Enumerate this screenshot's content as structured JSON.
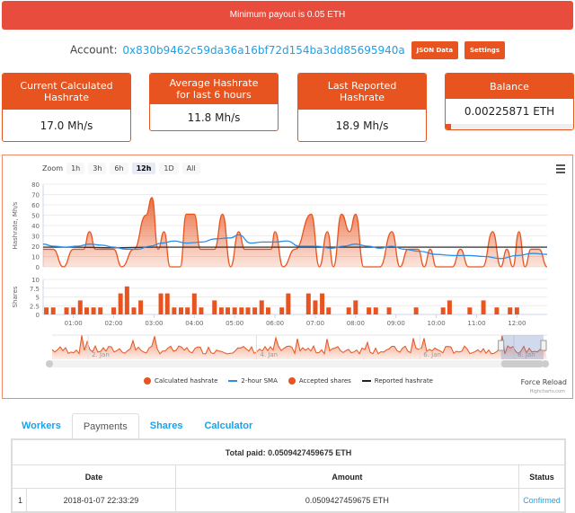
{
  "alert": {
    "text": "Minimum payout is 0.05 ETH"
  },
  "account": {
    "label": "Account:",
    "address": "0x830b9462c59da36a16bf72d154ba3dd85695940a",
    "json_button": "JSON Data",
    "settings_button": "Settings"
  },
  "cards": [
    {
      "title": "Current Calculated Hashrate",
      "value": "17.0 Mh/s"
    },
    {
      "title": "Average Hashrate for last 6 hours",
      "value": "11.8 Mh/s"
    },
    {
      "title": "Last Reported Hashrate",
      "value": "18.9 Mh/s"
    },
    {
      "title": "Balance",
      "value": "0.00225871 ETH",
      "progress": 0.045
    }
  ],
  "chart": {
    "zoom_label": "Zoom",
    "zoom_buttons": [
      "1h",
      "3h",
      "6h",
      "12h",
      "1D",
      "All"
    ],
    "active_zoom": "12h",
    "legend": [
      "Calculated hashrate",
      "2-hour SMA",
      "Accepted shares",
      "Reported hashrate"
    ],
    "force_reload": "Force Reload",
    "credits": "Highcharts.com",
    "colors": {
      "calculated": "#e8541f",
      "sma": "#2b8fe8",
      "shares": "#e8541f",
      "reported": "#333333"
    }
  },
  "chart_data": {
    "type": "line",
    "x_labels": [
      "01:00",
      "02:00",
      "03:00",
      "04:00",
      "05:00",
      "06:00",
      "07:00",
      "08:00",
      "09:00",
      "10:00",
      "11:00",
      "12:00"
    ],
    "x_range_hours": [
      0.25,
      12.35
    ],
    "hashrate_axis": {
      "label": "Hashrate, Mh/s",
      "ticks": [
        0,
        10,
        20,
        30,
        40,
        50,
        60,
        70,
        80
      ],
      "ylim": [
        0,
        80
      ]
    },
    "shares_axis": {
      "label": "Shares",
      "ticks": [
        "0",
        "2.5",
        "5",
        "7.5",
        "10"
      ],
      "ylim": [
        0,
        10
      ]
    },
    "series": [
      {
        "name": "Calculated hashrate",
        "type": "area",
        "points": [
          [
            0.25,
            17
          ],
          [
            0.5,
            17
          ],
          [
            0.75,
            0
          ],
          [
            1.0,
            17
          ],
          [
            1.25,
            17
          ],
          [
            1.4,
            34
          ],
          [
            1.55,
            17
          ],
          [
            2.0,
            17
          ],
          [
            2.2,
            0
          ],
          [
            2.5,
            17
          ],
          [
            2.8,
            50
          ],
          [
            2.95,
            67
          ],
          [
            3.1,
            17
          ],
          [
            3.25,
            34
          ],
          [
            3.4,
            0
          ],
          [
            3.65,
            0
          ],
          [
            3.8,
            51
          ],
          [
            4.0,
            51
          ],
          [
            4.15,
            17
          ],
          [
            4.5,
            17
          ],
          [
            4.7,
            51
          ],
          [
            4.9,
            0
          ],
          [
            5.1,
            34
          ],
          [
            5.25,
            17
          ],
          [
            5.9,
            17
          ],
          [
            6.0,
            34
          ],
          [
            6.2,
            0
          ],
          [
            6.5,
            17
          ],
          [
            6.9,
            51
          ],
          [
            7.1,
            0
          ],
          [
            7.3,
            34
          ],
          [
            7.45,
            0
          ],
          [
            7.65,
            51
          ],
          [
            7.85,
            34
          ],
          [
            8.0,
            51
          ],
          [
            8.2,
            0
          ],
          [
            8.6,
            0
          ],
          [
            8.9,
            34
          ],
          [
            9.1,
            0
          ],
          [
            9.3,
            17
          ],
          [
            9.55,
            17
          ],
          [
            9.7,
            0
          ],
          [
            9.85,
            17
          ],
          [
            10.0,
            0
          ],
          [
            10.4,
            0
          ],
          [
            10.6,
            17
          ],
          [
            10.8,
            0
          ],
          [
            11.15,
            0
          ],
          [
            11.4,
            34
          ],
          [
            11.6,
            0
          ],
          [
            11.75,
            17
          ],
          [
            11.9,
            0
          ],
          [
            12.05,
            34
          ],
          [
            12.2,
            0
          ],
          [
            12.35,
            17
          ],
          [
            12.55,
            17
          ],
          [
            12.75,
            0
          ]
        ]
      },
      {
        "name": "2-hour SMA",
        "type": "line",
        "points": [
          [
            0.25,
            22
          ],
          [
            0.5,
            20
          ],
          [
            0.8,
            19
          ],
          [
            1.1,
            20
          ],
          [
            1.4,
            22
          ],
          [
            1.7,
            21
          ],
          [
            2.0,
            19
          ],
          [
            2.3,
            17
          ],
          [
            2.6,
            17
          ],
          [
            2.9,
            20
          ],
          [
            3.2,
            23
          ],
          [
            3.5,
            25
          ],
          [
            3.8,
            23
          ],
          [
            4.2,
            24
          ],
          [
            4.5,
            27
          ],
          [
            4.9,
            28
          ],
          [
            5.1,
            31
          ],
          [
            5.4,
            23
          ],
          [
            5.7,
            24
          ],
          [
            6.0,
            24
          ],
          [
            6.3,
            25
          ],
          [
            6.6,
            20
          ],
          [
            7.0,
            20
          ],
          [
            7.4,
            18
          ],
          [
            7.7,
            20
          ],
          [
            8.0,
            22
          ],
          [
            8.3,
            20
          ],
          [
            8.6,
            18
          ],
          [
            8.9,
            20
          ],
          [
            9.2,
            17
          ],
          [
            9.6,
            15
          ],
          [
            10.0,
            12
          ],
          [
            10.4,
            11
          ],
          [
            10.8,
            11
          ],
          [
            11.2,
            10
          ],
          [
            11.6,
            8
          ],
          [
            12.0,
            11
          ],
          [
            12.4,
            13
          ],
          [
            12.75,
            12
          ]
        ]
      },
      {
        "name": "Reported hashrate",
        "type": "line",
        "points": [
          [
            0.25,
            19
          ],
          [
            1.0,
            19
          ],
          [
            2.0,
            18.5
          ],
          [
            3.0,
            19
          ],
          [
            4.0,
            19
          ],
          [
            5.0,
            19
          ],
          [
            6.0,
            19
          ],
          [
            7.0,
            19
          ],
          [
            8.0,
            19
          ],
          [
            9.0,
            19
          ],
          [
            10.0,
            19
          ],
          [
            11.0,
            19
          ],
          [
            12.0,
            19
          ],
          [
            12.75,
            19
          ]
        ]
      },
      {
        "name": "Accepted shares",
        "type": "bar",
        "points": [
          [
            0.33,
            2
          ],
          [
            0.5,
            2
          ],
          [
            0.83,
            2
          ],
          [
            1.0,
            2
          ],
          [
            1.17,
            4
          ],
          [
            1.33,
            2
          ],
          [
            1.5,
            2
          ],
          [
            1.67,
            2
          ],
          [
            2.0,
            2
          ],
          [
            2.17,
            6
          ],
          [
            2.33,
            8
          ],
          [
            2.5,
            2
          ],
          [
            2.67,
            4
          ],
          [
            3.17,
            6
          ],
          [
            3.33,
            6
          ],
          [
            3.5,
            2
          ],
          [
            3.67,
            2
          ],
          [
            3.83,
            2
          ],
          [
            4.0,
            6
          ],
          [
            4.17,
            2
          ],
          [
            4.5,
            4
          ],
          [
            4.67,
            2
          ],
          [
            4.83,
            2
          ],
          [
            5.0,
            2
          ],
          [
            5.17,
            2
          ],
          [
            5.33,
            2
          ],
          [
            5.5,
            2
          ],
          [
            5.67,
            4
          ],
          [
            5.83,
            2
          ],
          [
            6.17,
            2
          ],
          [
            6.33,
            6
          ],
          [
            6.83,
            6
          ],
          [
            7.0,
            4
          ],
          [
            7.17,
            6
          ],
          [
            7.33,
            2
          ],
          [
            7.83,
            2
          ],
          [
            8.0,
            4
          ],
          [
            8.33,
            2
          ],
          [
            8.5,
            2
          ],
          [
            8.83,
            2
          ],
          [
            9.5,
            2
          ],
          [
            10.17,
            2
          ],
          [
            10.33,
            4
          ],
          [
            10.83,
            2
          ],
          [
            11.17,
            4
          ],
          [
            11.5,
            2
          ],
          [
            11.83,
            2
          ],
          [
            12.0,
            2
          ]
        ]
      }
    ],
    "navigator": {
      "labels": [
        "2. Jan",
        "4. Jan",
        "6. Jan",
        "8. Jan"
      ],
      "selected_fraction": [
        0.925,
        1.0
      ]
    }
  },
  "tabs": [
    "Workers",
    "Payments",
    "Shares",
    "Calculator"
  ],
  "active_tab": "Payments",
  "payments": {
    "total": "Total paid: 0.0509427459675 ETH",
    "headers": [
      "Date",
      "Amount",
      "Status"
    ],
    "rows": [
      {
        "index": "1",
        "date": "2018-01-07 22:33:29",
        "amount": "0.0509427459675 ETH",
        "status": "Confirmed"
      }
    ]
  }
}
